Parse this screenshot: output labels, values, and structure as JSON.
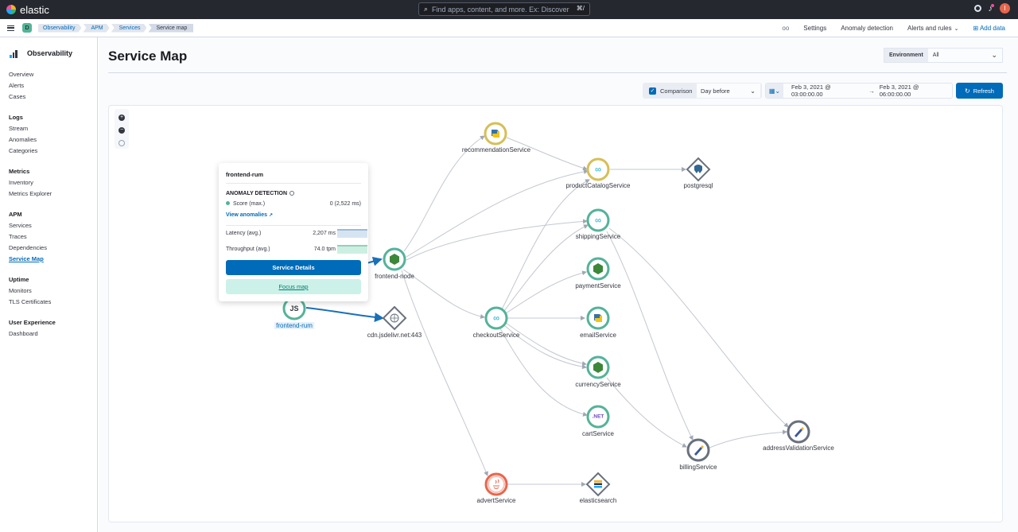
{
  "header": {
    "brand": "elastic",
    "search_placeholder": "Find apps, content, and more. Ex: Discover",
    "search_shortcut": "⌘/",
    "user_initial": "l"
  },
  "subbar": {
    "space_initial": "D",
    "breadcrumbs": [
      "Observability",
      "APM",
      "Services",
      "Service map"
    ],
    "nav": {
      "settings": "Settings",
      "anomaly": "Anomaly detection",
      "alerts": "Alerts and rules",
      "add_data": "Add data"
    }
  },
  "sidebar": {
    "title": "Observability",
    "groups": [
      {
        "head": "",
        "items": [
          "Overview",
          "Alerts",
          "Cases"
        ]
      },
      {
        "head": "Logs",
        "items": [
          "Stream",
          "Anomalies",
          "Categories"
        ]
      },
      {
        "head": "Metrics",
        "items": [
          "Inventory",
          "Metrics Explorer"
        ]
      },
      {
        "head": "APM",
        "items": [
          "Services",
          "Traces",
          "Dependencies",
          "Service Map"
        ]
      },
      {
        "head": "Uptime",
        "items": [
          "Monitors",
          "TLS Certificates"
        ]
      },
      {
        "head": "User Experience",
        "items": [
          "Dashboard"
        ]
      }
    ],
    "active_item": "Service Map"
  },
  "main": {
    "title": "Service Map",
    "environment_label": "Environment",
    "environment_value": "All",
    "comparison_label": "Comparison",
    "comparison_value": "Day before",
    "date_start": "Feb 3, 2021 @ 03:00:00.00",
    "date_arrow": "→",
    "date_end": "Feb 3, 2021 @ 06:00:00.00",
    "refresh_label": "Refresh"
  },
  "popover": {
    "title": "frontend-rum",
    "section": "ANOMALY DETECTION",
    "score_label": "Score (max.)",
    "score_value": "0 (2,522 ms)",
    "view_anomalies": "View anomalies",
    "latency_label": "Latency (avg.)",
    "latency_value": "2,207 ms",
    "throughput_label": "Throughput (avg.)",
    "throughput_value": "74.0 tpm",
    "primary_button": "Service Details",
    "secondary_button": "Focus map"
  },
  "nodes": {
    "recommendationService": "recommendationService",
    "productCatalogService": "productCatalogService",
    "postgresql": "postgresql",
    "shippingService": "shippingService",
    "paymentService": "paymentService",
    "emailService": "emailService",
    "currencyService": "currencyService",
    "cartService": "cartService",
    "checkoutService": "checkoutService",
    "frontendNode": "frontend-node",
    "frontendRum": "frontend-rum",
    "cdn": "cdn.jsdelivr.net:443",
    "billingService": "billingService",
    "addressValidationService": "addressValidationService",
    "advertService": "advertService",
    "elasticsearch": "elasticsearch",
    "cart_glyph": ".NET",
    "js_glyph": "JS"
  },
  "colors": {
    "accent": "#006bb8",
    "healthy": "#54b399",
    "warning": "#d6bf57",
    "critical": "#e7664c",
    "neutral": "#69707d"
  }
}
